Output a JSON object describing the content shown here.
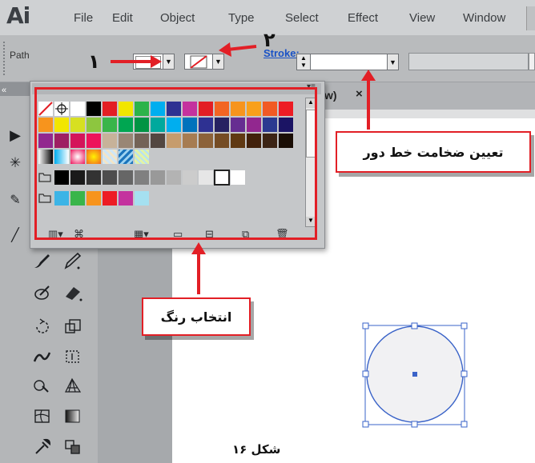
{
  "menubar": {
    "logo": "Ai",
    "items": [
      "File",
      "Edit",
      "Object",
      "Type",
      "Select",
      "Effect",
      "View",
      "Window"
    ]
  },
  "controlbar": {
    "path_label": "Path",
    "stroke_label": "Stroke:"
  },
  "document_tab": {
    "title_fragment": "w)",
    "close_glyph": "×"
  },
  "annotations": {
    "num_1": "۱",
    "num_2": "۲",
    "stroke_weight_callout": "تعیین ضخامت خط دور",
    "color_select_callout": "انتخاب رنگ",
    "caption": "شکل ۱۶"
  },
  "swatches": {
    "row1": [
      "#ffffff",
      "#ffffff",
      "#ffffff",
      "#000000",
      "#e31e24",
      "#f2e600",
      "#2cb34a",
      "#00aeef",
      "#2e3192",
      "#c4329e",
      "#e31e24",
      "#f26522",
      "#f7941d",
      "#f9a01b"
    ],
    "row2": [
      "#f7941d",
      "#f2e600",
      "#c5d82e",
      "#8dc63f",
      "#39b54a",
      "#00a651",
      "#00a99d",
      "#00aeef",
      "#0072bc",
      "#2e3192",
      "#662d91",
      "#92278f"
    ],
    "row3": [
      "#92278f",
      "#9e1f63",
      "#ed145b",
      "#ed1c24",
      "#c69c6d",
      "#a67c52",
      "#8c6239",
      "#754c24",
      "#603913",
      "#3c2415",
      "#c7b299",
      "#998675",
      "#736357",
      "#534741",
      "#362f2d"
    ],
    "gray_row": [
      "#000000",
      "#1a1a1a",
      "#333333",
      "#4d4d4d",
      "#666666",
      "#808080",
      "#999999",
      "#b3b3b3",
      "#cccccc",
      "#e6e6e6",
      "#ffffff",
      "#ffffff"
    ],
    "bright_row": [
      "#3cb4e6",
      "#39b54a",
      "#f7941d",
      "#ed1c24",
      "#c4329e",
      "#a5e0f0"
    ]
  },
  "colors": {
    "annotation_red": "#e21f26",
    "selection_blue": "#3a63c8"
  }
}
